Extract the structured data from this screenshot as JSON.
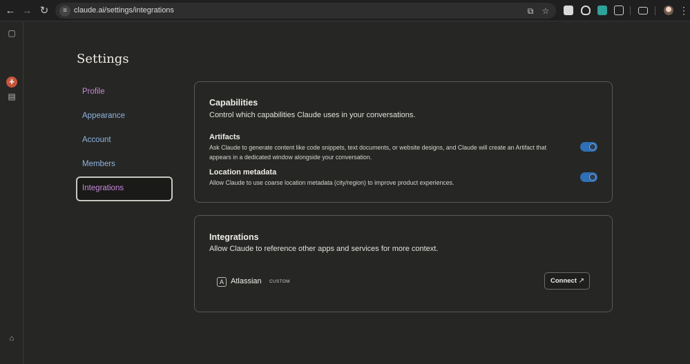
{
  "browser": {
    "url": "claude.ai/settings/integrations",
    "icons": [
      "back-icon",
      "forward-icon",
      "reload-icon",
      "site-settings-icon",
      "cast-icon",
      "bookmark-star-icon",
      "extensions-icon",
      "tab-search-icon",
      "profile-avatar",
      "menu-icon"
    ]
  },
  "rail": {
    "icons": [
      "sidebar-toggle-icon",
      "new-chat-icon",
      "search-chats-icon",
      "projects-icon",
      "account-icon"
    ]
  },
  "page": {
    "title": "Settings"
  },
  "nav": {
    "items": [
      {
        "label": "Profile"
      },
      {
        "label": "Appearance"
      },
      {
        "label": "Account"
      },
      {
        "label": "Members"
      },
      {
        "label": "Integrations"
      }
    ],
    "active": "Integrations"
  },
  "capabilities": {
    "title": "Capabilities",
    "subtitle": "Control which capabilities Claude uses in your conversations.",
    "items": [
      {
        "title": "Artifacts",
        "description": "Ask Claude to generate content like code snippets, text documents, or website designs, and Claude will create an Artifact that appears in a dedicated window alongside your conversation.",
        "enabled": true
      },
      {
        "title": "Location metadata",
        "description": "Allow Claude to use coarse location metadata (city/region) to improve product experiences.",
        "enabled": true
      }
    ]
  },
  "integrations": {
    "title": "Integrations",
    "subtitle": "Allow Claude to reference other apps and services for more context.",
    "items": [
      {
        "icon_letter": "A",
        "name": "Atlassian",
        "badge": "CUSTOM",
        "action": "Connect"
      }
    ]
  },
  "colors": {
    "background": "#262624",
    "accent_purple": "#c78ad6",
    "nav_blue": "#8fb4e0",
    "toggle_on": "#2f6fb5"
  }
}
